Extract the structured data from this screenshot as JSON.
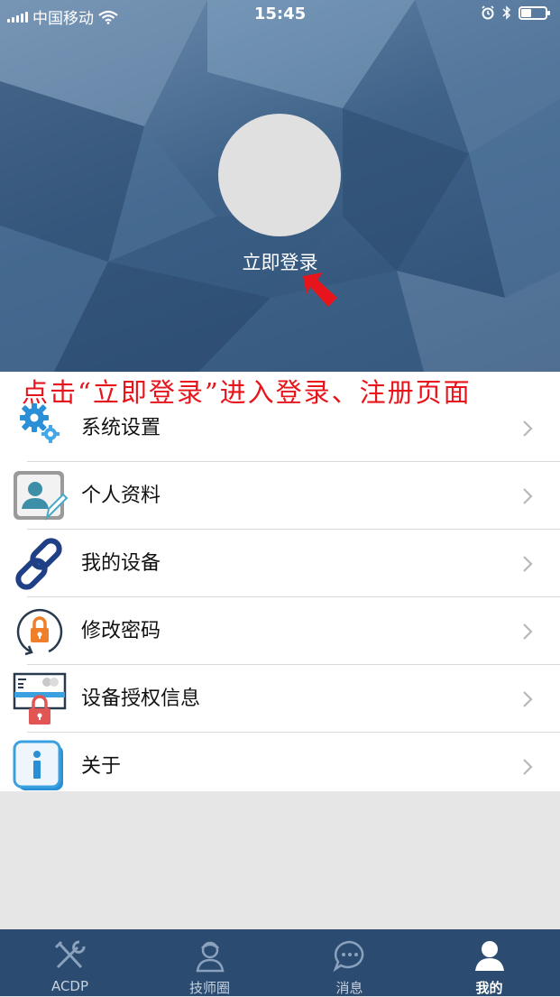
{
  "status_bar": {
    "carrier": "中国移动",
    "time": "15:45"
  },
  "header": {
    "login_text": "立即登录"
  },
  "annotation": "点击“立即登录”进入登录、注册页面",
  "menu": {
    "items": [
      {
        "label": "系统设置",
        "icon": "gears-icon"
      },
      {
        "label": "个人资料",
        "icon": "profile-card-icon"
      },
      {
        "label": "我的设备",
        "icon": "chain-link-icon"
      },
      {
        "label": "修改密码",
        "icon": "lock-cycle-icon"
      },
      {
        "label": "设备授权信息",
        "icon": "device-lock-icon"
      },
      {
        "label": "关于",
        "icon": "info-icon"
      }
    ]
  },
  "tabbar": {
    "tabs": [
      {
        "label": "ACDP",
        "icon": "tools-icon",
        "active": false
      },
      {
        "label": "技师圈",
        "icon": "technician-icon",
        "active": false
      },
      {
        "label": "消息",
        "icon": "chat-bubble-icon",
        "active": false
      },
      {
        "label": "我的",
        "icon": "person-icon",
        "active": true
      }
    ]
  },
  "colors": {
    "header_bg": "#3f6288",
    "tabbar_bg": "#2b4b70",
    "annotation_red": "#e8141b"
  }
}
